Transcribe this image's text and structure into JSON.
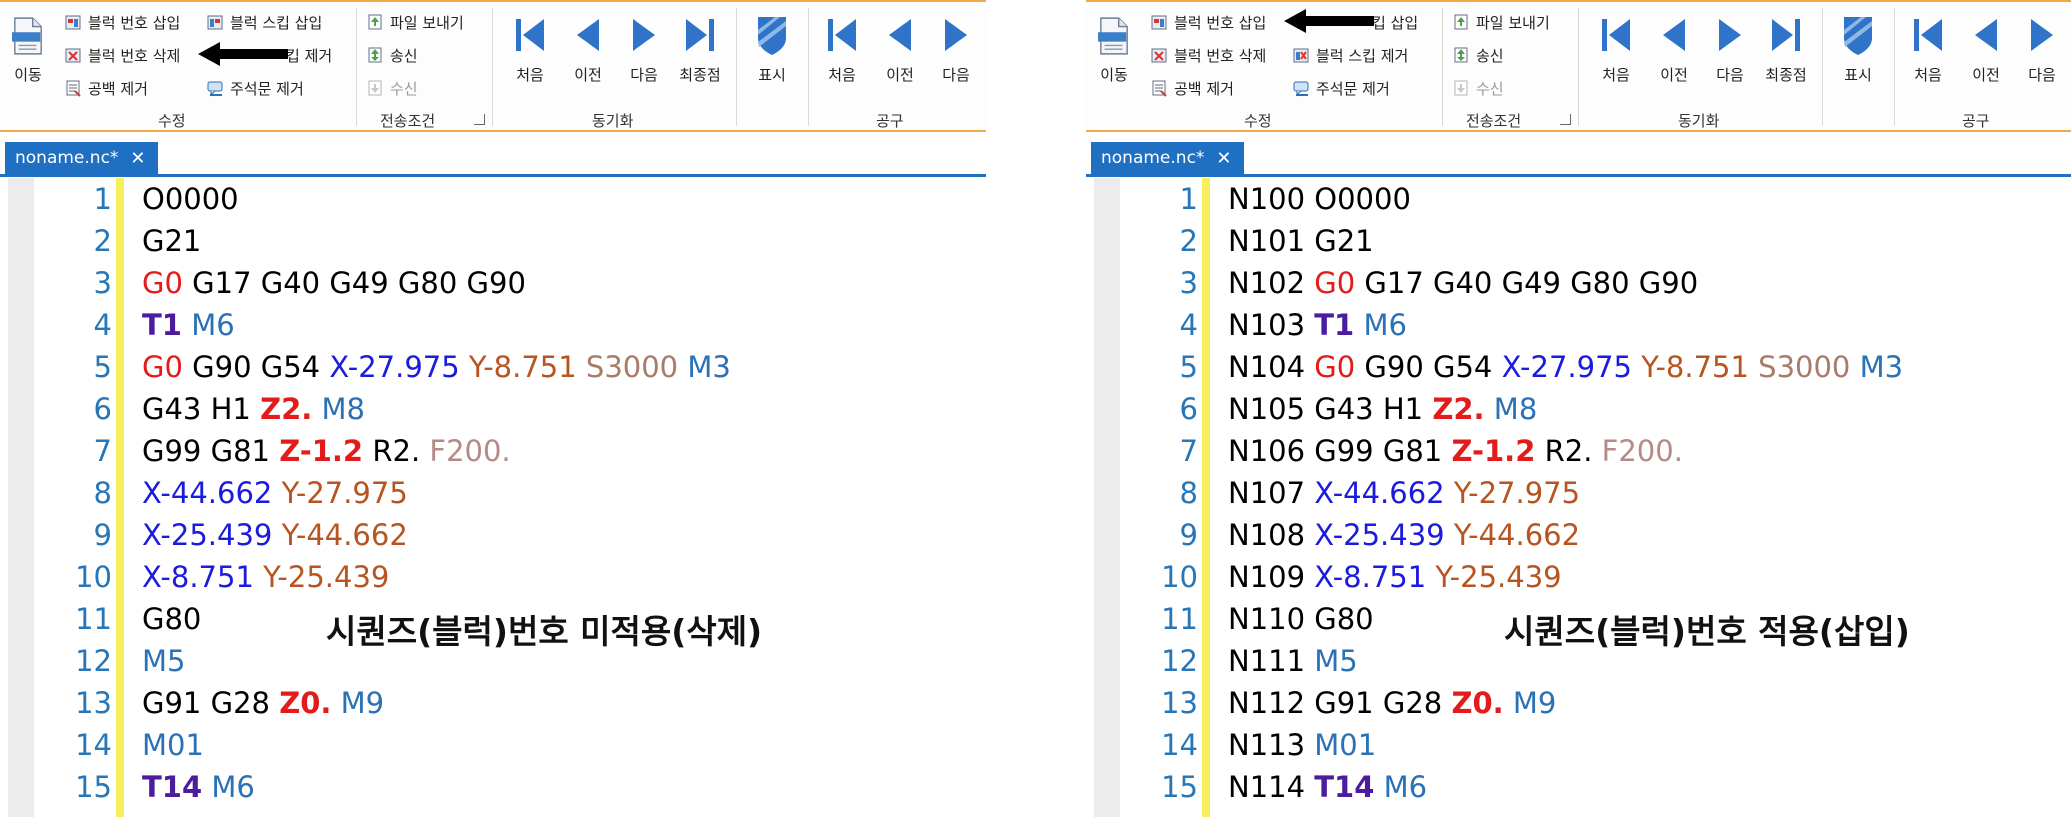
{
  "ribbon": {
    "move_label": "이동",
    "insert_block_number": "블럭 번호 삽입",
    "insert_block_skip": "블럭 스킵 삽입",
    "delete_block_number": "블럭 번호 삭제",
    "remove_block_skip": "블럭 스킵 제거",
    "remove_block_skip_fragment": "킵 제거",
    "insert_block_skip_fragment": "킵 삽입",
    "remove_whitespace": "공백 제거",
    "remove_comments": "주석문 제거",
    "group_edit": "수정",
    "send_file": "파일 보내기",
    "transmit": "송신",
    "receive": "수신",
    "group_transfer": "전송조건",
    "nav_first": "처음",
    "nav_prev": "이전",
    "nav_next": "다음",
    "nav_last": "최종점",
    "group_sync": "동기화",
    "show": "표시",
    "group_tools": "공구"
  },
  "tab": {
    "name": "noname.nc*",
    "close": "✕"
  },
  "line_numbers": [
    "1",
    "2",
    "3",
    "4",
    "5",
    "6",
    "7",
    "8",
    "9",
    "10",
    "11",
    "12",
    "13",
    "14",
    "15"
  ],
  "left_code": [
    [
      [
        "O0000",
        "n"
      ]
    ],
    [
      [
        "G21",
        "n"
      ]
    ],
    [
      [
        "G0",
        "red"
      ],
      [
        " G17 G40 G49 G80 G90",
        "n"
      ]
    ],
    [
      [
        "T1",
        "t"
      ],
      [
        " ",
        "n"
      ],
      [
        "M6",
        "m"
      ]
    ],
    [
      [
        "G0",
        "red"
      ],
      [
        " G90 G54 ",
        "n"
      ],
      [
        "X-27.975",
        "x"
      ],
      [
        " ",
        "n"
      ],
      [
        "Y-8.751",
        "y"
      ],
      [
        " ",
        "n"
      ],
      [
        "S3000",
        "s"
      ],
      [
        " ",
        "n"
      ],
      [
        "M3",
        "m"
      ]
    ],
    [
      [
        "G43 H1 ",
        "n"
      ],
      [
        "Z2.",
        "redb"
      ],
      [
        " ",
        "n"
      ],
      [
        "M8",
        "m"
      ]
    ],
    [
      [
        "G99 G81 ",
        "n"
      ],
      [
        "Z-1.2",
        "redb"
      ],
      [
        " R2. ",
        "n"
      ],
      [
        "F200.",
        "f"
      ]
    ],
    [
      [
        "X-44.662",
        "x"
      ],
      [
        " ",
        "n"
      ],
      [
        "Y-27.975",
        "y"
      ]
    ],
    [
      [
        "X-25.439",
        "x"
      ],
      [
        " ",
        "n"
      ],
      [
        "Y-44.662",
        "y"
      ]
    ],
    [
      [
        "X-8.751",
        "x"
      ],
      [
        " ",
        "n"
      ],
      [
        "Y-25.439",
        "y"
      ]
    ],
    [
      [
        "G80",
        "n"
      ]
    ],
    [
      [
        "M5",
        "m"
      ]
    ],
    [
      [
        "G91 G28 ",
        "n"
      ],
      [
        "Z0.",
        "redb"
      ],
      [
        " ",
        "n"
      ],
      [
        "M9",
        "m"
      ]
    ],
    [
      [
        "M01",
        "m"
      ]
    ],
    [
      [
        "T14",
        "t"
      ],
      [
        " ",
        "n"
      ],
      [
        "M6",
        "m"
      ]
    ]
  ],
  "right_code": [
    [
      [
        "N100 O0000",
        "n"
      ]
    ],
    [
      [
        "N101 G21",
        "n"
      ]
    ],
    [
      [
        "N102 ",
        "n"
      ],
      [
        "G0",
        "red"
      ],
      [
        " G17 G40 G49 G80 G90",
        "n"
      ]
    ],
    [
      [
        "N103 ",
        "n"
      ],
      [
        "T1",
        "t"
      ],
      [
        " ",
        "n"
      ],
      [
        "M6",
        "m"
      ]
    ],
    [
      [
        "N104 ",
        "n"
      ],
      [
        "G0",
        "red"
      ],
      [
        " G90 G54 ",
        "n"
      ],
      [
        "X-27.975",
        "x"
      ],
      [
        " ",
        "n"
      ],
      [
        "Y-8.751",
        "y"
      ],
      [
        " ",
        "n"
      ],
      [
        "S3000",
        "s"
      ],
      [
        " ",
        "n"
      ],
      [
        "M3",
        "m"
      ]
    ],
    [
      [
        "N105 G43 H1 ",
        "n"
      ],
      [
        "Z2.",
        "redb"
      ],
      [
        " ",
        "n"
      ],
      [
        "M8",
        "m"
      ]
    ],
    [
      [
        "N106 G99 G81 ",
        "n"
      ],
      [
        "Z-1.2",
        "redb"
      ],
      [
        " R2. ",
        "n"
      ],
      [
        "F200.",
        "f"
      ]
    ],
    [
      [
        "N107 ",
        "n"
      ],
      [
        "X-44.662",
        "x"
      ],
      [
        " ",
        "n"
      ],
      [
        "Y-27.975",
        "y"
      ]
    ],
    [
      [
        "N108 ",
        "n"
      ],
      [
        "X-25.439",
        "x"
      ],
      [
        " ",
        "n"
      ],
      [
        "Y-44.662",
        "y"
      ]
    ],
    [
      [
        "N109 ",
        "n"
      ],
      [
        "X-8.751",
        "x"
      ],
      [
        " ",
        "n"
      ],
      [
        "Y-25.439",
        "y"
      ]
    ],
    [
      [
        "N110 G80",
        "n"
      ]
    ],
    [
      [
        "N111 ",
        "n"
      ],
      [
        "M5",
        "m"
      ]
    ],
    [
      [
        "N112 G91 G28 ",
        "n"
      ],
      [
        "Z0.",
        "redb"
      ],
      [
        " ",
        "n"
      ],
      [
        "M9",
        "m"
      ]
    ],
    [
      [
        "N113 ",
        "n"
      ],
      [
        "M01",
        "m"
      ]
    ],
    [
      [
        "N114 ",
        "n"
      ],
      [
        "T14",
        "t"
      ],
      [
        " ",
        "n"
      ],
      [
        "M6",
        "m"
      ]
    ]
  ],
  "annotations": {
    "left": "시퀀즈(블럭)번호 미적용(삭제)",
    "right": "시퀀즈(블럭)번호 적용(삽입)"
  },
  "colors": {
    "accent_orange": "#f0a84a",
    "tab_blue": "#1f6fc2",
    "gutter_yellow": "#f7f05a",
    "line_number_blue": "#2676b8"
  }
}
